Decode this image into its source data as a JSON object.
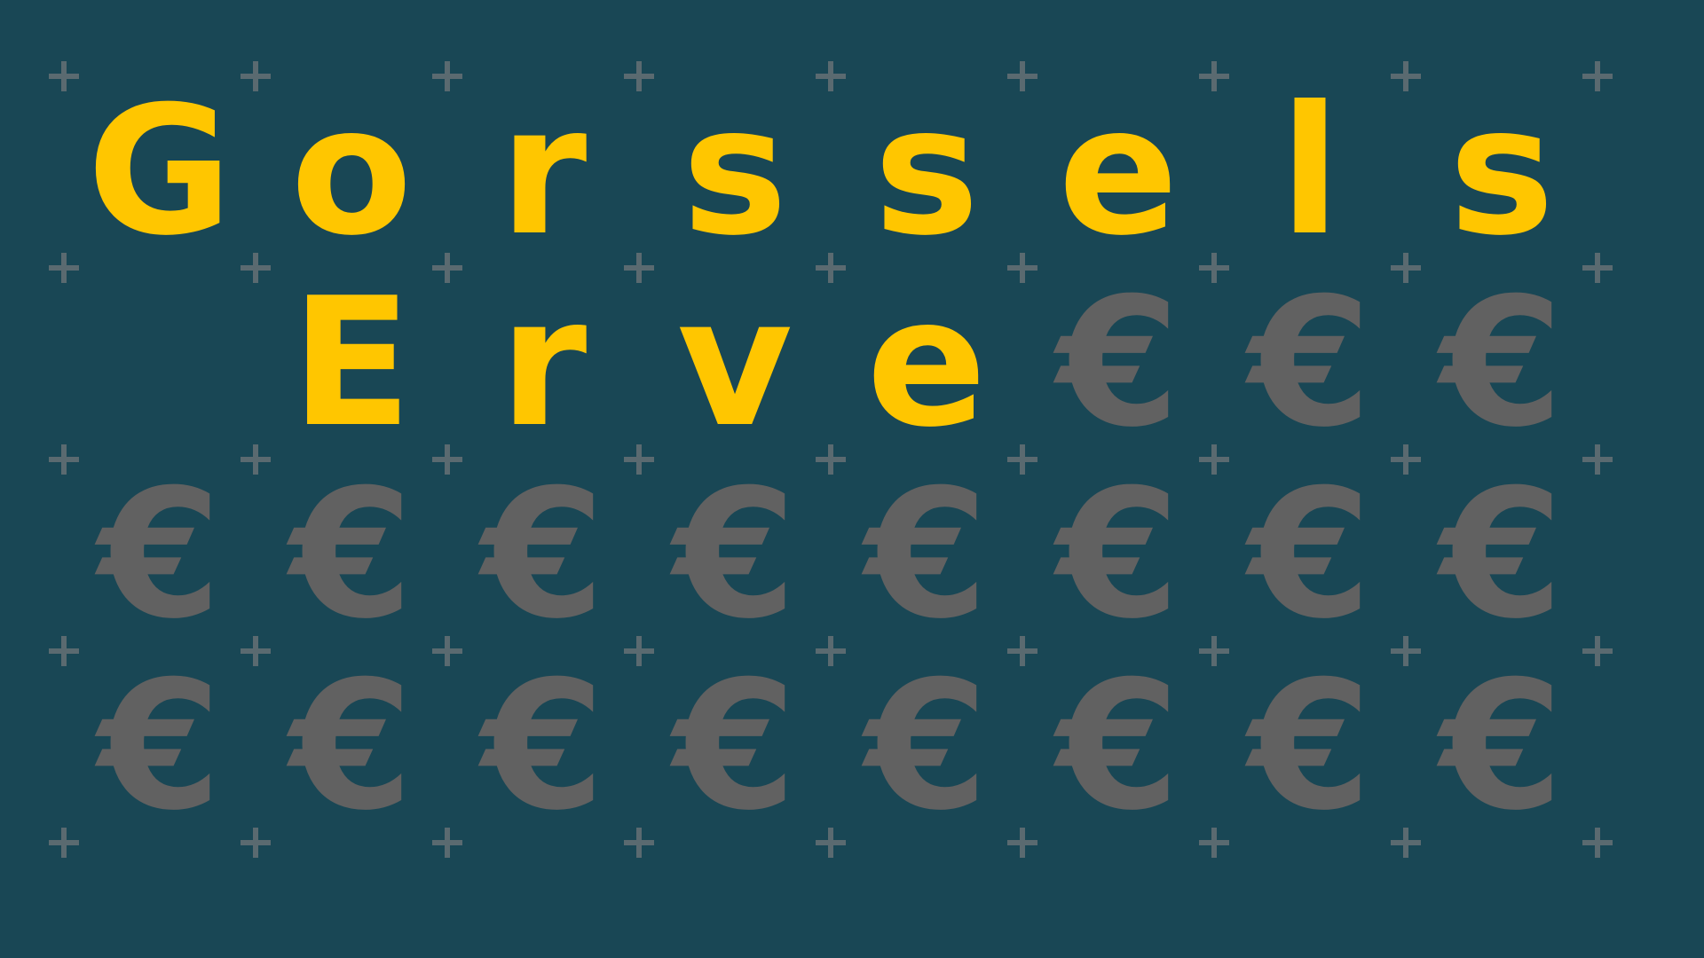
{
  "colors": {
    "background": "#194755",
    "letter": "#FFC600",
    "euro": "#616161",
    "plus": "#5A6A70"
  },
  "grid": {
    "columns": 8,
    "rows": 4
  },
  "letters": [
    "G",
    "o",
    "r",
    "s",
    "s",
    "e",
    "l",
    "s",
    " ",
    "E",
    "r",
    "v",
    "e"
  ],
  "filler_symbol": "€",
  "plus_symbol": "plus-icon"
}
